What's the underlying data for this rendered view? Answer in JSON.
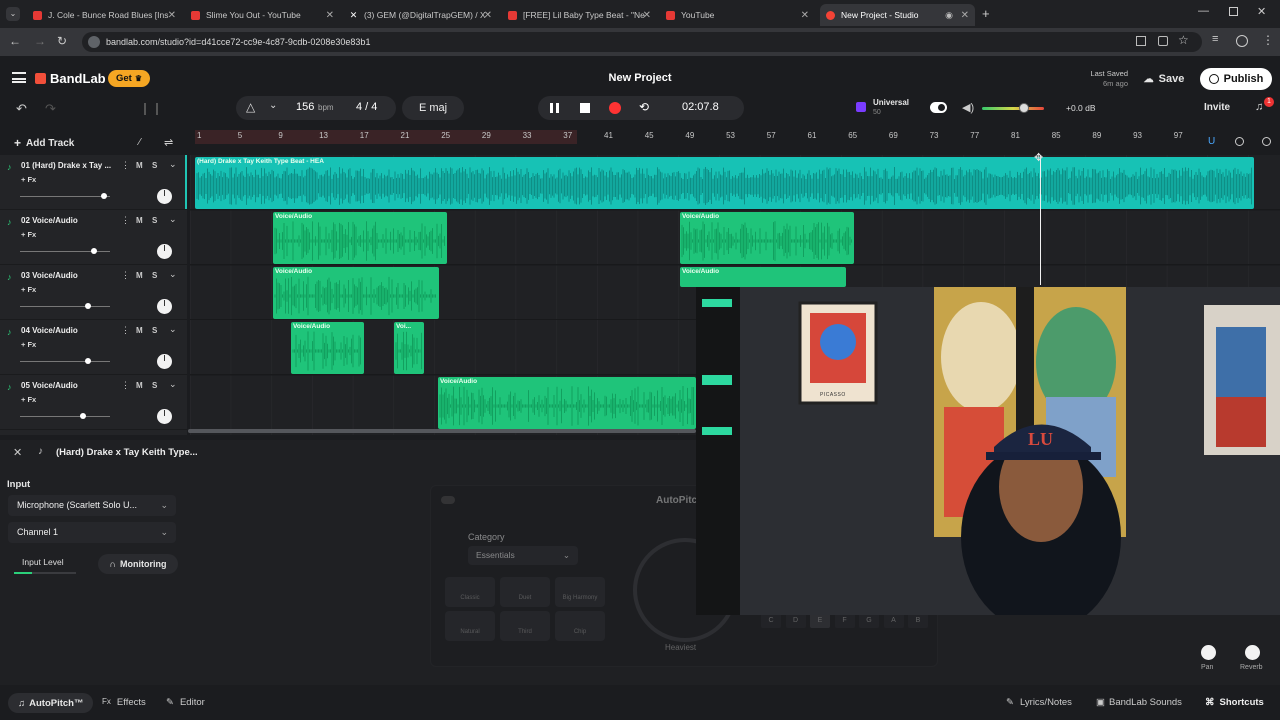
{
  "browser": {
    "tabs": [
      {
        "label": "J. Cole - Bunce Road Blues [Ins",
        "color": "#e53935"
      },
      {
        "label": "Slime You Out - YouTube",
        "color": "#e53935"
      },
      {
        "label": "(3) GEM (@DigitalTrapGEM) / X",
        "color": "#ffffff"
      },
      {
        "label": "[FREE] Lil Baby Type Beat - \"Ne",
        "color": "#e53935"
      },
      {
        "label": "YouTube",
        "color": "#e53935"
      },
      {
        "label": "New Project - Studio",
        "color": "#f44336"
      }
    ],
    "url": "bandlab.com/studio?id=d41cce72-cc9e-4c87-9cdb-0208e30e83b1"
  },
  "header": {
    "brand": "BandLab",
    "get_label": "Get",
    "title": "New Project",
    "last_saved_label": "Last Saved",
    "last_saved_time": "6m ago",
    "save_label": "Save",
    "publish_label": "Publish",
    "invite_label": "Invite",
    "notification_count": "1"
  },
  "transport": {
    "bpm": "156",
    "bpm_unit": "bpm",
    "time_signature": "4 / 4",
    "key": "E maj",
    "time": "02:07.8",
    "universal_label": "Universal",
    "universal_sub": "50",
    "volume_db": "+0.0 dB"
  },
  "ruler": {
    "add_track_label": "Add Track",
    "ticks": [
      "1",
      "5",
      "9",
      "13",
      "17",
      "21",
      "25",
      "29",
      "33",
      "37",
      "41",
      "45",
      "49",
      "53",
      "57",
      "61",
      "65",
      "69",
      "73",
      "77",
      "81",
      "85",
      "89",
      "93",
      "97"
    ],
    "loop_end_bar": "37"
  },
  "tracks": [
    {
      "name": "01  (Hard) Drake x Tay ...",
      "fx": "+ Fx",
      "mute": "M",
      "solo": "S",
      "level": 0.93
    },
    {
      "name": "02  Voice/Audio",
      "fx": "+ Fx",
      "mute": "M",
      "solo": "S",
      "level": 0.82
    },
    {
      "name": "03  Voice/Audio",
      "fx": "+ Fx",
      "mute": "M",
      "solo": "S",
      "level": 0.75
    },
    {
      "name": "04  Voice/Audio",
      "fx": "+ Fx",
      "mute": "M",
      "solo": "S",
      "level": 0.75
    },
    {
      "name": "05  Voice/Audio",
      "fx": "+ Fx",
      "mute": "M",
      "solo": "S",
      "level": 0.7
    }
  ],
  "clips": {
    "beat_label": "(Hard) Drake x Tay Keith Type Beat - HEA",
    "voice_label": "Voice/Audio",
    "voice_short": "Voi..."
  },
  "lower_panel": {
    "selected_track": "(Hard) Drake x Tay Keith Type...",
    "input_label": "Input",
    "input_device": "Microphone (Scarlett Solo U...",
    "channel": "Channel 1",
    "input_level_label": "Input Level",
    "monitoring_label": "Monitoring",
    "category_label": "Category",
    "category_value": "Essentials",
    "autopitch_title": "AutoPitch",
    "presets": [
      "Classic",
      "Duet",
      "Big Harmony",
      "Natural",
      "Third",
      "Chip"
    ],
    "keys": [
      "C",
      "D",
      "E",
      "F",
      "G",
      "A",
      "B"
    ],
    "heaviest_label": "Heaviest",
    "pan_label": "Pan",
    "reverb_label": "Reverb"
  },
  "bottom_bar": {
    "autopitch_label": "AutoPitch™",
    "effects_label": "Effects",
    "editor_label": "Editor",
    "lyrics_label": "Lyrics/Notes",
    "sounds_label": "BandLab Sounds",
    "shortcuts_label": "Shortcuts"
  },
  "webcam": {
    "poster_caption": "PICASSO"
  },
  "colors": {
    "accent": "#f24f3a",
    "beat_clip": "#17c2b5",
    "voice_clip": "#1fc47a"
  }
}
